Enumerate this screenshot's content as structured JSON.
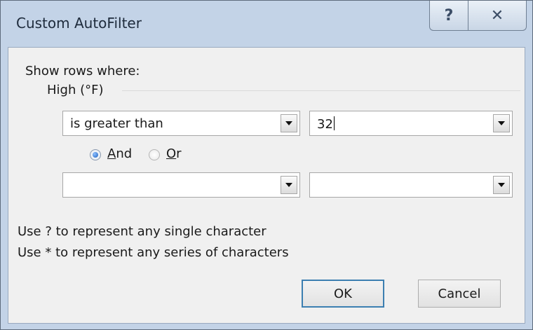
{
  "window": {
    "title": "Custom AutoFilter",
    "help_glyph": "?",
    "close_glyph": "✕"
  },
  "filter": {
    "show_rows_label": "Show rows where:",
    "column_label": "High (°F)",
    "criteria1_operator": "is greater than",
    "criteria1_value": "32",
    "and_label_accel": "A",
    "and_label_rest": "nd",
    "or_label_accel": "O",
    "or_label_rest": "r",
    "logic_selected": "And",
    "criteria2_operator": "",
    "criteria2_value": ""
  },
  "hints": {
    "line1": "Use ? to represent any single character",
    "line2": "Use * to represent any series of characters"
  },
  "buttons": {
    "ok": "OK",
    "cancel": "Cancel"
  },
  "colors": {
    "frame": "#c3d3e7",
    "client": "#f0f0f0",
    "default_button_border": "#3c7fb1",
    "radio_selected": "#1b5fbf"
  }
}
